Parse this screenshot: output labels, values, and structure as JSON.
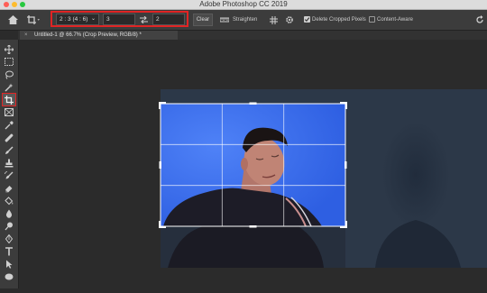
{
  "window": {
    "title": "Adobe Photoshop CC 2019"
  },
  "options_bar": {
    "aspect_ratio": "2 : 3 (4 : 6)",
    "width_value": "3",
    "height_value": "2",
    "clear_label": "Clear",
    "straighten_label": "Straighten",
    "delete_cropped_label": "Delete Cropped Pixels",
    "delete_cropped_checked": true,
    "content_aware_label": "Content-Aware",
    "content_aware_checked": false
  },
  "document_tab": {
    "label": "Untitled-1 @ 66.7% (Crop Preview, RGB/8)",
    "modified_marker": "*",
    "close_glyph": "×"
  },
  "toolbar": {
    "active_tool": "crop-tool",
    "tools": [
      "move-tool",
      "marquee-tool",
      "lasso-tool",
      "quick-select-tool",
      "crop-tool",
      "frame-tool",
      "eyedropper-tool",
      "healing-tool",
      "brush-tool",
      "clone-stamp-tool",
      "history-brush-tool",
      "eraser-tool",
      "paint-bucket-tool",
      "blur-tool",
      "dodge-tool",
      "pen-tool",
      "type-tool",
      "path-select-tool",
      "ellipse-tool"
    ]
  },
  "colors": {
    "crop_highlight": "#e02424",
    "photo_background": "#3d70ee",
    "panel": "#3c3c3c"
  }
}
